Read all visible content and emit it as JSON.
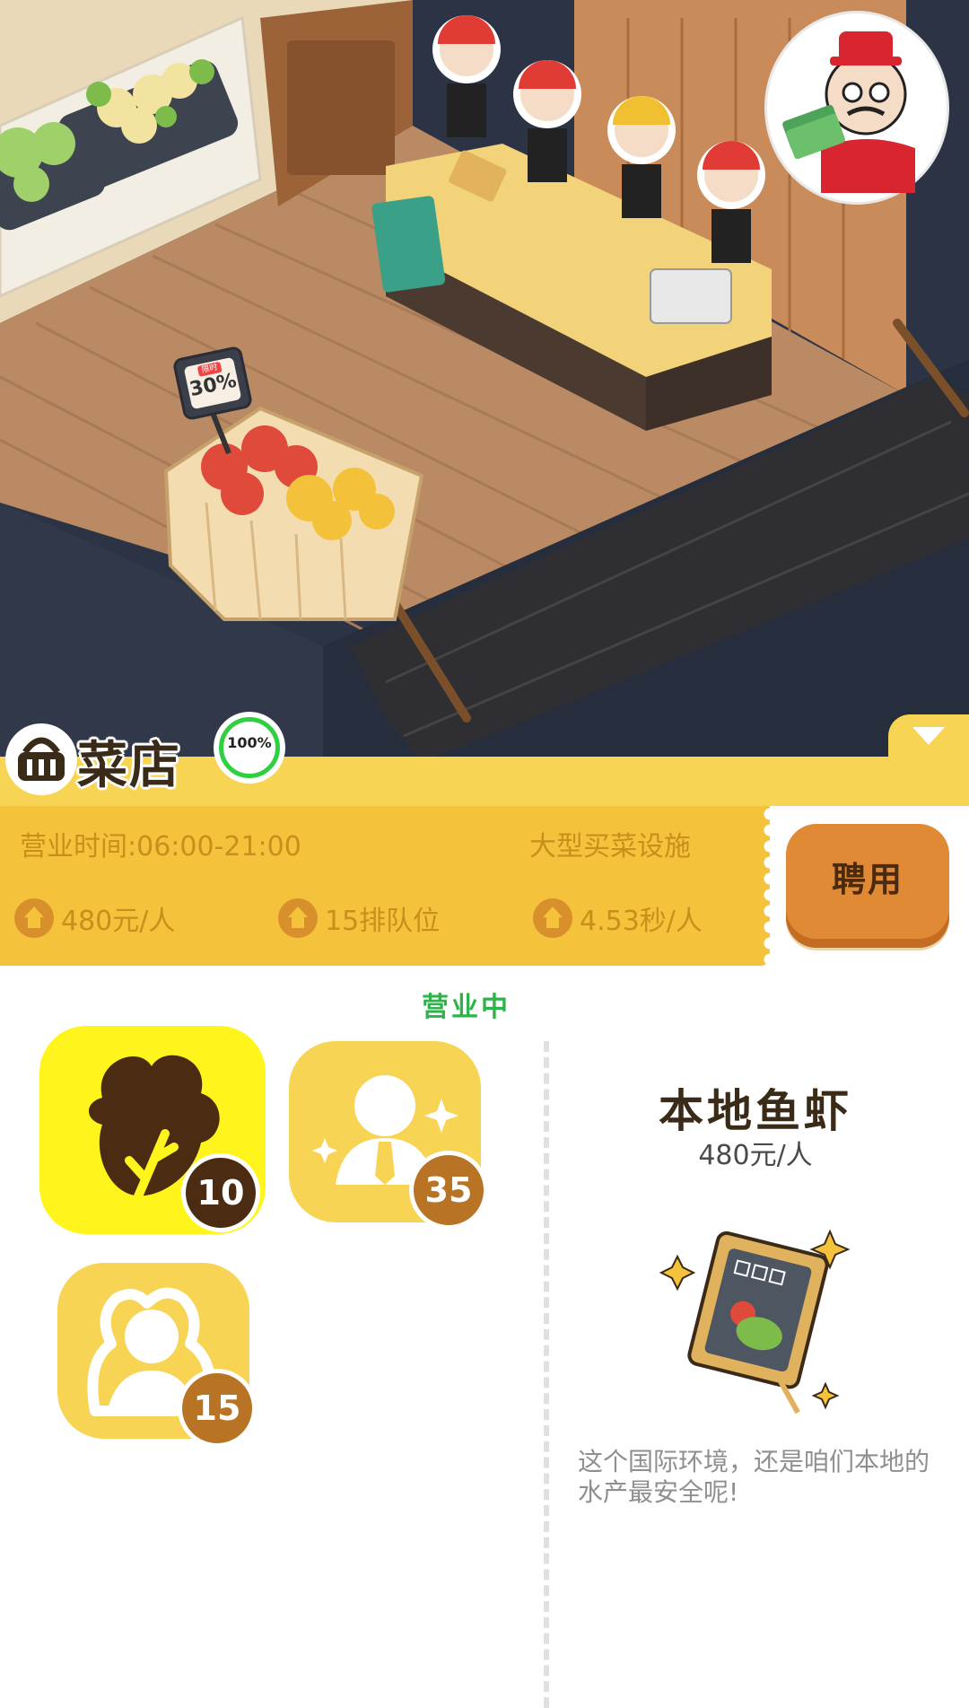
{
  "scene": {
    "discount_tag": {
      "label": "限时",
      "value": "30%"
    }
  },
  "shop": {
    "title": "菜店",
    "progress": "100%",
    "hours": "营业时间:06:00-21:00",
    "facility": "大型买菜设施",
    "stats": [
      {
        "icon": "house-icon",
        "text": "480元/人"
      },
      {
        "icon": "house-icon",
        "text": "15排队位"
      },
      {
        "icon": "house-icon",
        "text": "4.53秒/人"
      }
    ],
    "hire_label": "聘用",
    "status": "营业中"
  },
  "tiles": [
    {
      "icon": "vegetable-icon",
      "badge": "10",
      "selected": true
    },
    {
      "icon": "staff-icon",
      "badge": "35",
      "selected": false
    },
    {
      "icon": "customer-icon",
      "badge": "15",
      "selected": false
    }
  ],
  "detail": {
    "name": "本地鱼虾",
    "price": "480元/人",
    "description": "这个国际环境，还是咱们本地的水产最安全呢!"
  },
  "colors": {
    "panel_yellow": "#f7d453",
    "ticket_yellow": "#f4c23b",
    "hire_orange": "#e08a36",
    "status_green": "#2db34a"
  }
}
